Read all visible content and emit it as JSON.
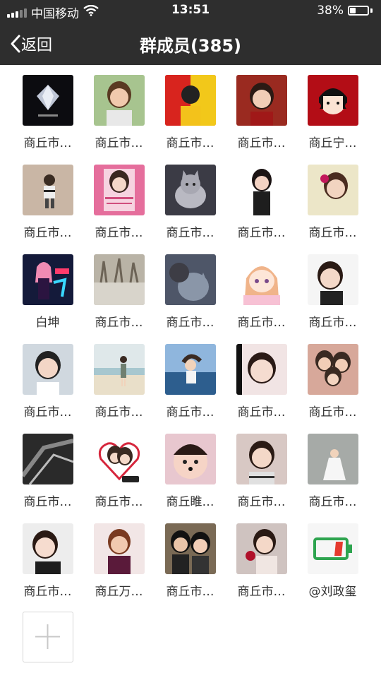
{
  "status": {
    "carrier": "中国移动",
    "time": "13:51",
    "battery": "38%",
    "battery_level": 0.38
  },
  "nav": {
    "back_label": "返回",
    "title": "群成员(385)"
  },
  "members": [
    {
      "name": "商丘市…",
      "avatar": "dark-diamond-logo"
    },
    {
      "name": "商丘市…",
      "avatar": "woman-portrait"
    },
    {
      "name": "商丘市…",
      "avatar": "masked-figure-red"
    },
    {
      "name": "商丘市…",
      "avatar": "woman-red-background"
    },
    {
      "name": "商丘宁…",
      "avatar": "cartoon-girl"
    },
    {
      "name": "商丘市…",
      "avatar": "child-photo"
    },
    {
      "name": "商丘市…",
      "avatar": "pink-card"
    },
    {
      "name": "商丘市…",
      "avatar": "cat-photo"
    },
    {
      "name": "商丘市…",
      "avatar": "girl-portrait"
    },
    {
      "name": "商丘市…",
      "avatar": "woman-flower"
    },
    {
      "name": "白坤",
      "avatar": "neon-anime"
    },
    {
      "name": "商丘市…",
      "avatar": "snow-trees"
    },
    {
      "name": "商丘市…",
      "avatar": "person-with-cat"
    },
    {
      "name": "商丘市…",
      "avatar": "anime-girl"
    },
    {
      "name": "商丘市…",
      "avatar": "woman-selfie"
    },
    {
      "name": "商丘市…",
      "avatar": "young-man"
    },
    {
      "name": "商丘市…",
      "avatar": "beach-girl"
    },
    {
      "name": "商丘市…",
      "avatar": "sea-girl"
    },
    {
      "name": "商丘市…",
      "avatar": "girl-closeup"
    },
    {
      "name": "商丘市…",
      "avatar": "family-photo"
    },
    {
      "name": "商丘市…",
      "avatar": "bw-art"
    },
    {
      "name": "商丘市…",
      "avatar": "heart-frame"
    },
    {
      "name": "商丘睢…",
      "avatar": "baby-photo"
    },
    {
      "name": "商丘市…",
      "avatar": "woman-smile"
    },
    {
      "name": "商丘市…",
      "avatar": "white-dress"
    },
    {
      "name": "商丘市…",
      "avatar": "woman-selfie-2"
    },
    {
      "name": "商丘万…",
      "avatar": "woman-glam"
    },
    {
      "name": "商丘市…",
      "avatar": "couple-photo"
    },
    {
      "name": "商丘市…",
      "avatar": "woman-rose"
    },
    {
      "name": "@刘政玺",
      "avatar": "low-battery-icon"
    }
  ],
  "add_button": {
    "icon": "plus-icon"
  }
}
